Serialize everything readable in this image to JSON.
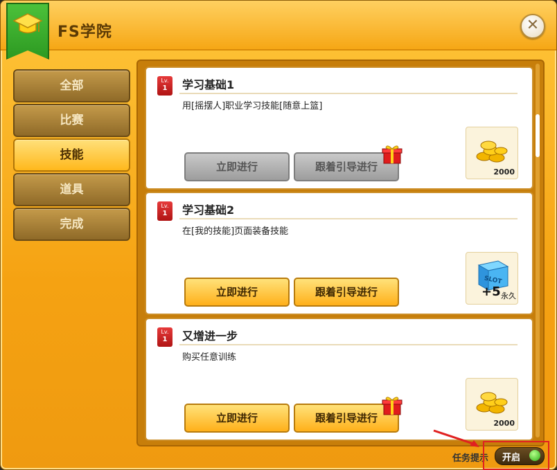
{
  "window": {
    "title": "FS学院",
    "close_icon": "close-icon"
  },
  "tabs": [
    {
      "label": "全部",
      "active": false
    },
    {
      "label": "比赛",
      "active": false
    },
    {
      "label": "技能",
      "active": true
    },
    {
      "label": "道具",
      "active": false
    },
    {
      "label": "完成",
      "active": false
    }
  ],
  "quests": [
    {
      "level_prefix": "Lv.",
      "level": "1",
      "title": "学习基础1",
      "desc": "用[摇摆人]职业学习技能[随意上篮]",
      "go_label": "立即进行",
      "guide_label": "跟着引导进行",
      "enabled": false,
      "gift": true,
      "reward": {
        "type": "coins",
        "count": "2000"
      }
    },
    {
      "level_prefix": "Lv.",
      "level": "1",
      "title": "学习基础2",
      "desc": "在[我的技能]页面装备技能",
      "go_label": "立即进行",
      "guide_label": "跟着引导进行",
      "enabled": true,
      "gift": false,
      "reward": {
        "type": "slot",
        "plus": "+5",
        "suffix": "永久",
        "box_text": "SLOT"
      }
    },
    {
      "level_prefix": "Lv.",
      "level": "1",
      "title": "又增进一步",
      "desc": "购买任意训练",
      "go_label": "立即进行",
      "guide_label": "跟着引导进行",
      "enabled": true,
      "gift": true,
      "reward": {
        "type": "coins",
        "count": "2000"
      }
    }
  ],
  "footer": {
    "hint_label": "任务提示",
    "toggle_label": "开启",
    "toggle_on": true
  },
  "colors": {
    "accent": "#ffb81c",
    "frame": "#c77e0a",
    "toggle_dot": "#2cae17",
    "highlight": "#e02020"
  }
}
